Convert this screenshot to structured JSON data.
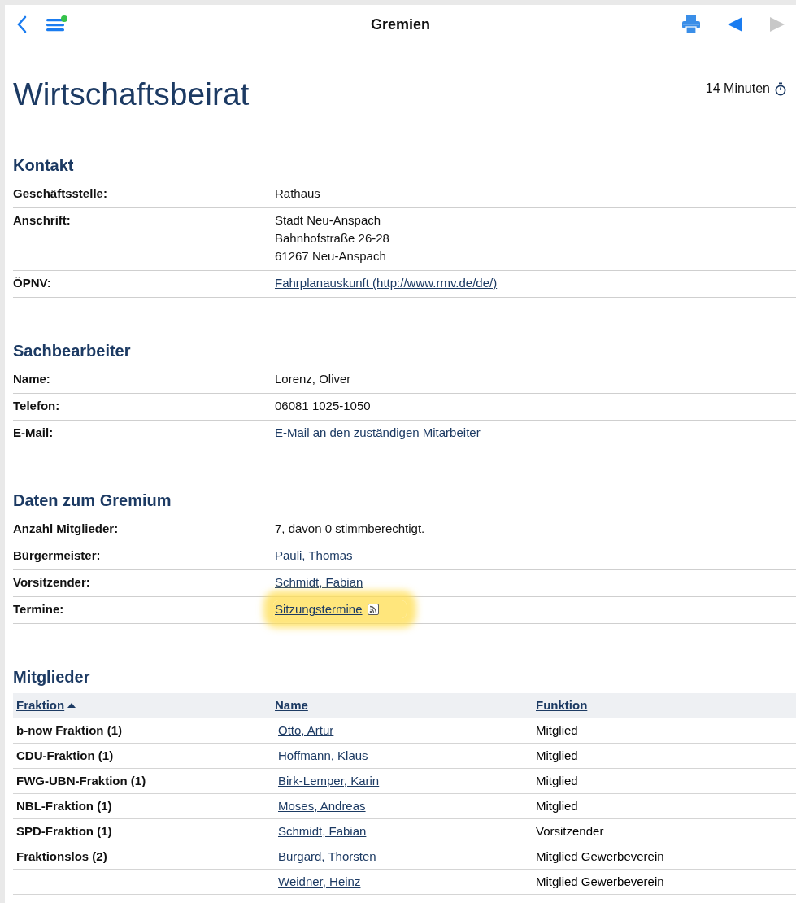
{
  "nav": {
    "title": "Gremien",
    "menu_badge": true,
    "back_enabled": true,
    "forward_enabled": false
  },
  "page": {
    "title": "Wirtschaftsbeirat",
    "reading_time": "14 Minuten"
  },
  "sections": [
    {
      "heading": "Kontakt",
      "rows": [
        {
          "label": "Geschäftsstelle:",
          "lines": [
            "Rathaus"
          ],
          "link": false,
          "highlighted": false
        },
        {
          "label": "Anschrift:",
          "lines": [
            "Stadt Neu-Anspach",
            "Bahnhofstraße 26-28",
            "61267 Neu-Anspach"
          ],
          "link": false,
          "highlighted": false
        },
        {
          "label": "ÖPNV:",
          "lines": [
            "Fahrplanauskunft (http://www.rmv.de/de/)"
          ],
          "link": true,
          "highlighted": false
        }
      ]
    },
    {
      "heading": "Sachbearbeiter",
      "rows": [
        {
          "label": "Name:",
          "lines": [
            "Lorenz, Oliver"
          ],
          "link": false,
          "highlighted": false
        },
        {
          "label": "Telefon:",
          "lines": [
            "06081 1025-1050"
          ],
          "link": false,
          "highlighted": false
        },
        {
          "label": "E-Mail:",
          "lines": [
            "E-Mail an den zuständigen Mitarbeiter"
          ],
          "link": true,
          "highlighted": false
        }
      ]
    },
    {
      "heading": "Daten zum Gremium",
      "rows": [
        {
          "label": "Anzahl Mitglieder:",
          "lines": [
            "7, davon 0 stimmberechtigt."
          ],
          "link": false,
          "highlighted": false
        },
        {
          "label": "Bürgermeister:",
          "lines": [
            "Pauli, Thomas"
          ],
          "link": true,
          "highlighted": false
        },
        {
          "label": "Vorsitzender:",
          "lines": [
            "Schmidt, Fabian"
          ],
          "link": true,
          "highlighted": false
        },
        {
          "label": "Termine:",
          "lines": [
            "Sitzungstermine"
          ],
          "link": true,
          "highlighted": true,
          "feed": true
        }
      ]
    }
  ],
  "members": {
    "heading": "Mitglieder",
    "columns": [
      {
        "label": "Fraktion",
        "sorted": true
      },
      {
        "label": "Name",
        "sorted": false
      },
      {
        "label": "Funktion",
        "sorted": false
      }
    ],
    "rows": [
      {
        "fraktion": "b-now Fraktion (1)",
        "name": "Otto, Artur",
        "funktion": "Mitglied"
      },
      {
        "fraktion": "CDU-Fraktion (1)",
        "name": "Hoffmann, Klaus",
        "funktion": "Mitglied"
      },
      {
        "fraktion": "FWG-UBN-Fraktion (1)",
        "name": "Birk-Lemper, Karin",
        "funktion": "Mitglied"
      },
      {
        "fraktion": "NBL-Fraktion (1)",
        "name": "Moses, Andreas",
        "funktion": "Mitglied"
      },
      {
        "fraktion": "SPD-Fraktion (1)",
        "name": "Schmidt, Fabian",
        "funktion": "Vorsitzender"
      },
      {
        "fraktion": "Fraktionslos (2)",
        "name": "Burgard, Thorsten",
        "funktion": "Mitglied Gewerbeverein"
      },
      {
        "name": "Weidner, Heinz",
        "funktion": "Mitglied Gewerbeverein"
      }
    ]
  }
}
